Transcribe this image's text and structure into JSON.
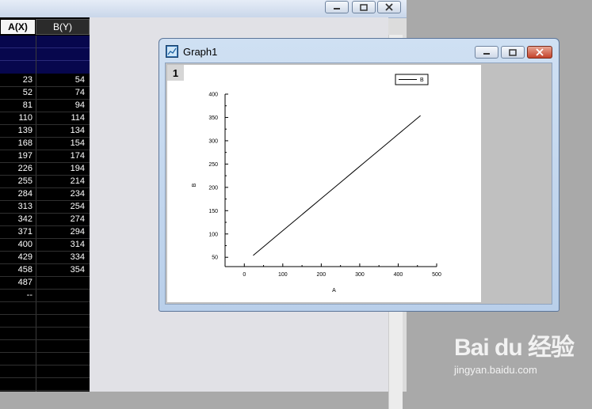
{
  "worksheet": {
    "columns": [
      {
        "label": "A(X)"
      },
      {
        "label": "B(Y)"
      }
    ],
    "rows": [
      {
        "a": "23",
        "b": "54"
      },
      {
        "a": "52",
        "b": "74"
      },
      {
        "a": "81",
        "b": "94"
      },
      {
        "a": "110",
        "b": "114"
      },
      {
        "a": "139",
        "b": "134"
      },
      {
        "a": "168",
        "b": "154"
      },
      {
        "a": "197",
        "b": "174"
      },
      {
        "a": "226",
        "b": "194"
      },
      {
        "a": "255",
        "b": "214"
      },
      {
        "a": "284",
        "b": "234"
      },
      {
        "a": "313",
        "b": "254"
      },
      {
        "a": "342",
        "b": "274"
      },
      {
        "a": "371",
        "b": "294"
      },
      {
        "a": "400",
        "b": "314"
      },
      {
        "a": "429",
        "b": "334"
      },
      {
        "a": "458",
        "b": "354"
      },
      {
        "a": "487",
        "b": ""
      },
      {
        "a": "--",
        "b": ""
      },
      {
        "a": "",
        "b": ""
      },
      {
        "a": "",
        "b": ""
      },
      {
        "a": "",
        "b": ""
      },
      {
        "a": "",
        "b": ""
      },
      {
        "a": "",
        "b": ""
      },
      {
        "a": "",
        "b": ""
      },
      {
        "a": "",
        "b": ""
      }
    ]
  },
  "graph_window": {
    "title": "Graph1",
    "layer_number": "1",
    "colors": {
      "line": "#000000",
      "background": "#ffffff"
    }
  },
  "chart_data": {
    "type": "line",
    "xlabel": "A",
    "ylabel": "B",
    "xlim": [
      -50,
      500
    ],
    "ylim": [
      30,
      400
    ],
    "xticks": [
      0,
      100,
      200,
      300,
      400,
      500
    ],
    "yticks": [
      50,
      100,
      150,
      200,
      250,
      300,
      350,
      400
    ],
    "legend": {
      "placement": "top-right"
    },
    "series": [
      {
        "name": "B",
        "x": [
          23,
          52,
          81,
          110,
          139,
          168,
          197,
          226,
          255,
          284,
          313,
          342,
          371,
          400,
          429,
          458
        ],
        "values": [
          54,
          74,
          94,
          114,
          134,
          154,
          174,
          194,
          214,
          234,
          254,
          274,
          294,
          314,
          334,
          354
        ]
      }
    ]
  },
  "watermark": {
    "logo": "Bai du 经验",
    "url": "jingyan.baidu.com"
  }
}
